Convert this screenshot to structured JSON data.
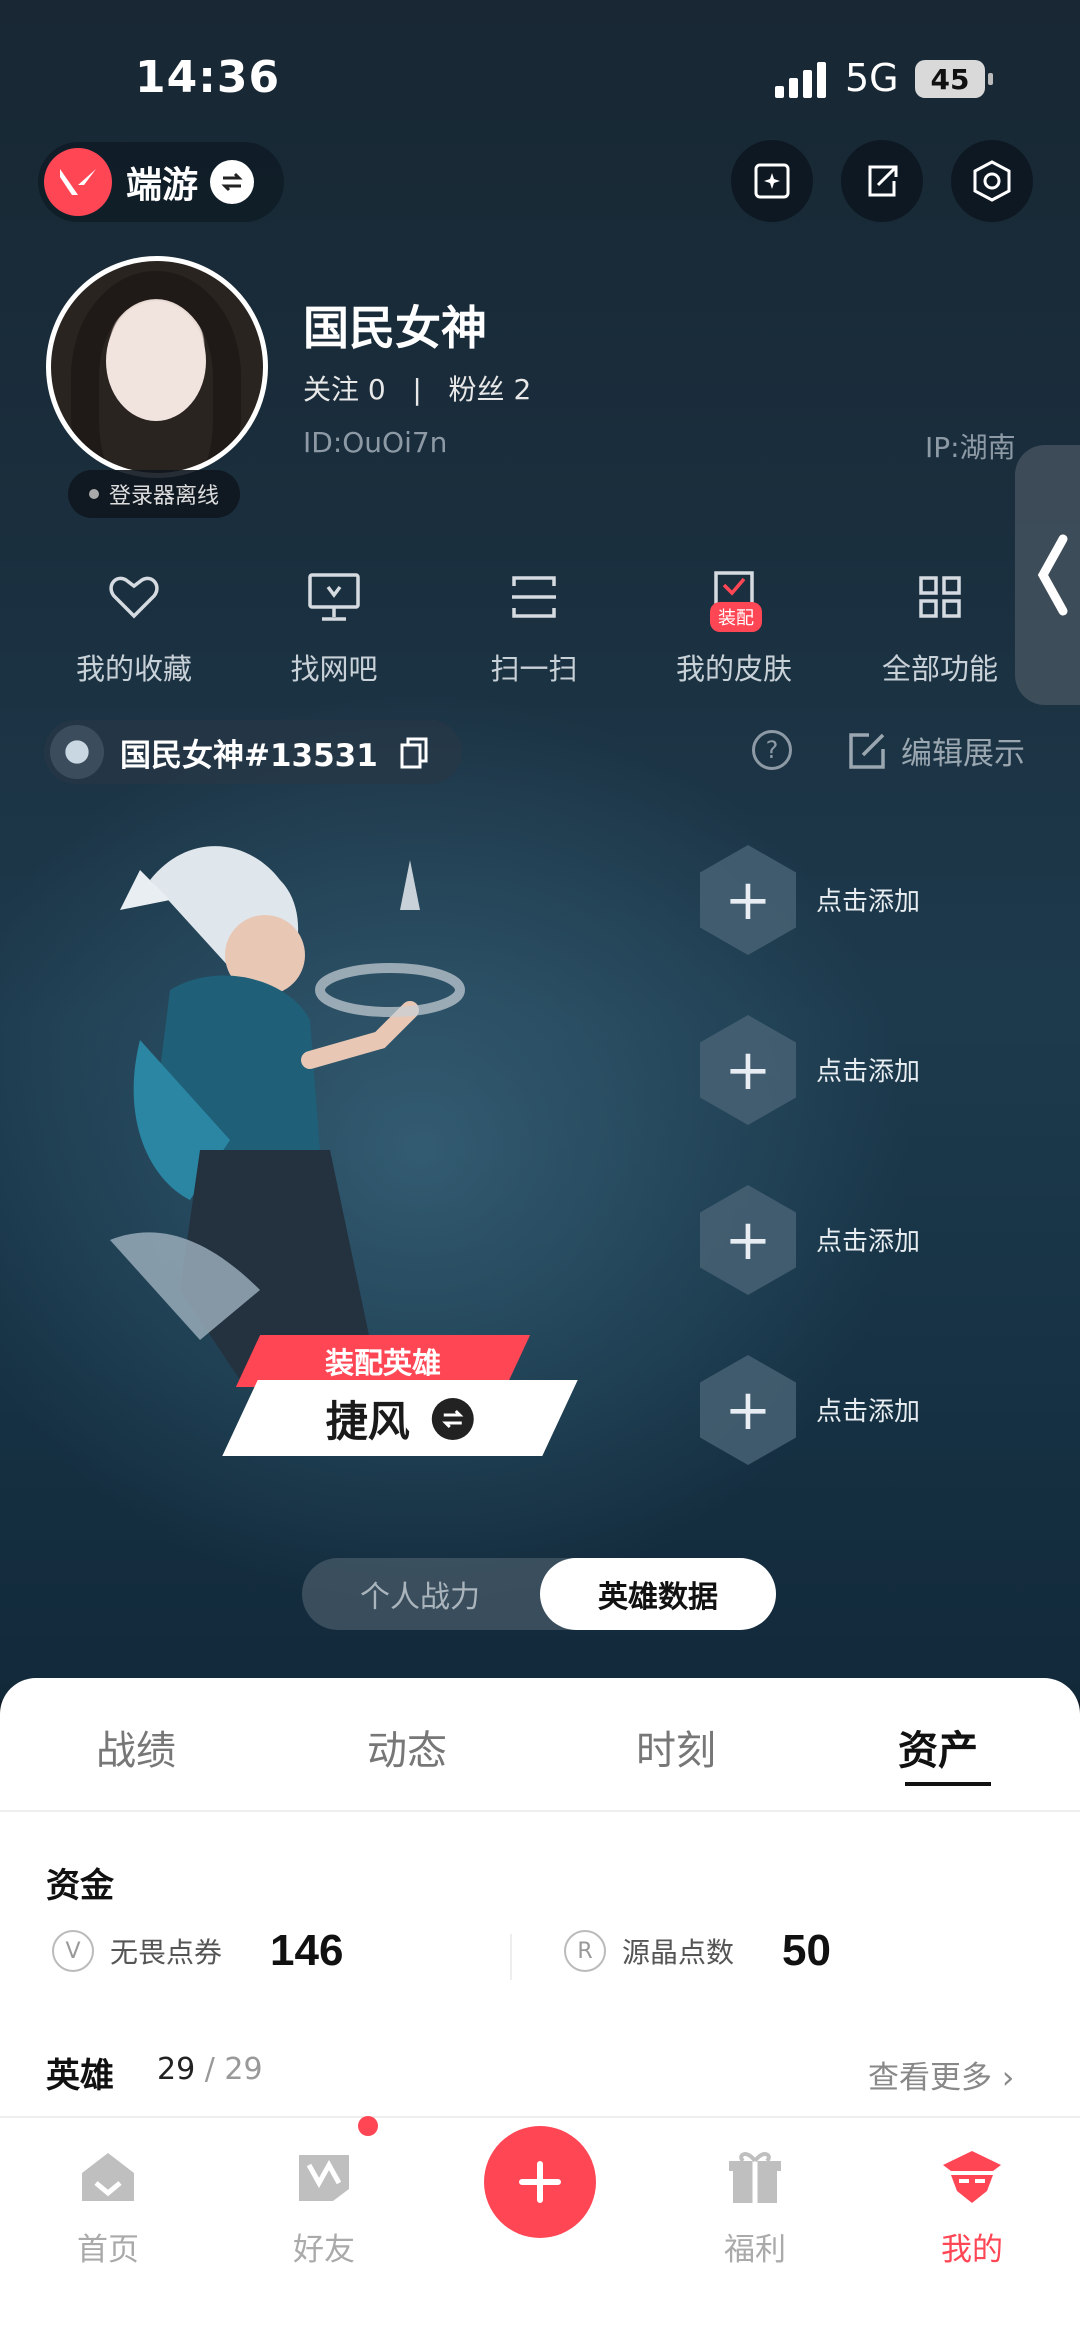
{
  "status": {
    "time": "14:36",
    "network": "5G",
    "battery": "45"
  },
  "header": {
    "app_label": "端游"
  },
  "profile": {
    "name": "国民女神",
    "follow_text": "关注 0   |   粉丝 2",
    "id_text": "ID:OuOi7n",
    "ip_text": "IP:湖南",
    "login_status": "登录器离线"
  },
  "quick_actions": [
    {
      "label": "我的收藏",
      "icon": "heart-icon"
    },
    {
      "label": "找网吧",
      "icon": "monitor-icon"
    },
    {
      "label": "扫一扫",
      "icon": "scan-icon"
    },
    {
      "label": "我的皮肤",
      "icon": "skin-icon",
      "badge": "装配"
    },
    {
      "label": "全部功能",
      "icon": "grid-icon"
    }
  ],
  "riot_tag": "国民女神#13531",
  "edit_display": "编辑展示",
  "hero": {
    "equip_label": "装配英雄",
    "name": "捷风"
  },
  "slots": [
    "点击添加",
    "点击添加",
    "点击添加",
    "点击添加"
  ],
  "toggle": {
    "left": "个人战力",
    "right": "英雄数据"
  },
  "tabs": [
    "战绩",
    "动态",
    "时刻",
    "资产"
  ],
  "assets": {
    "fund_title": "资金",
    "currencies": [
      {
        "label": "无畏点券",
        "value": "146"
      },
      {
        "label": "源晶点数",
        "value": "50"
      }
    ],
    "heroes_title": "英雄",
    "heroes_owned": "29",
    "heroes_sep": " / ",
    "heroes_total": "29",
    "see_more": "查看更多 ›"
  },
  "nav": [
    {
      "label": "首页"
    },
    {
      "label": "好友"
    },
    {
      "label": "福利"
    },
    {
      "label": "我的"
    }
  ],
  "colors": {
    "accent": "#ff4655",
    "bg": "#1a2e3d"
  }
}
